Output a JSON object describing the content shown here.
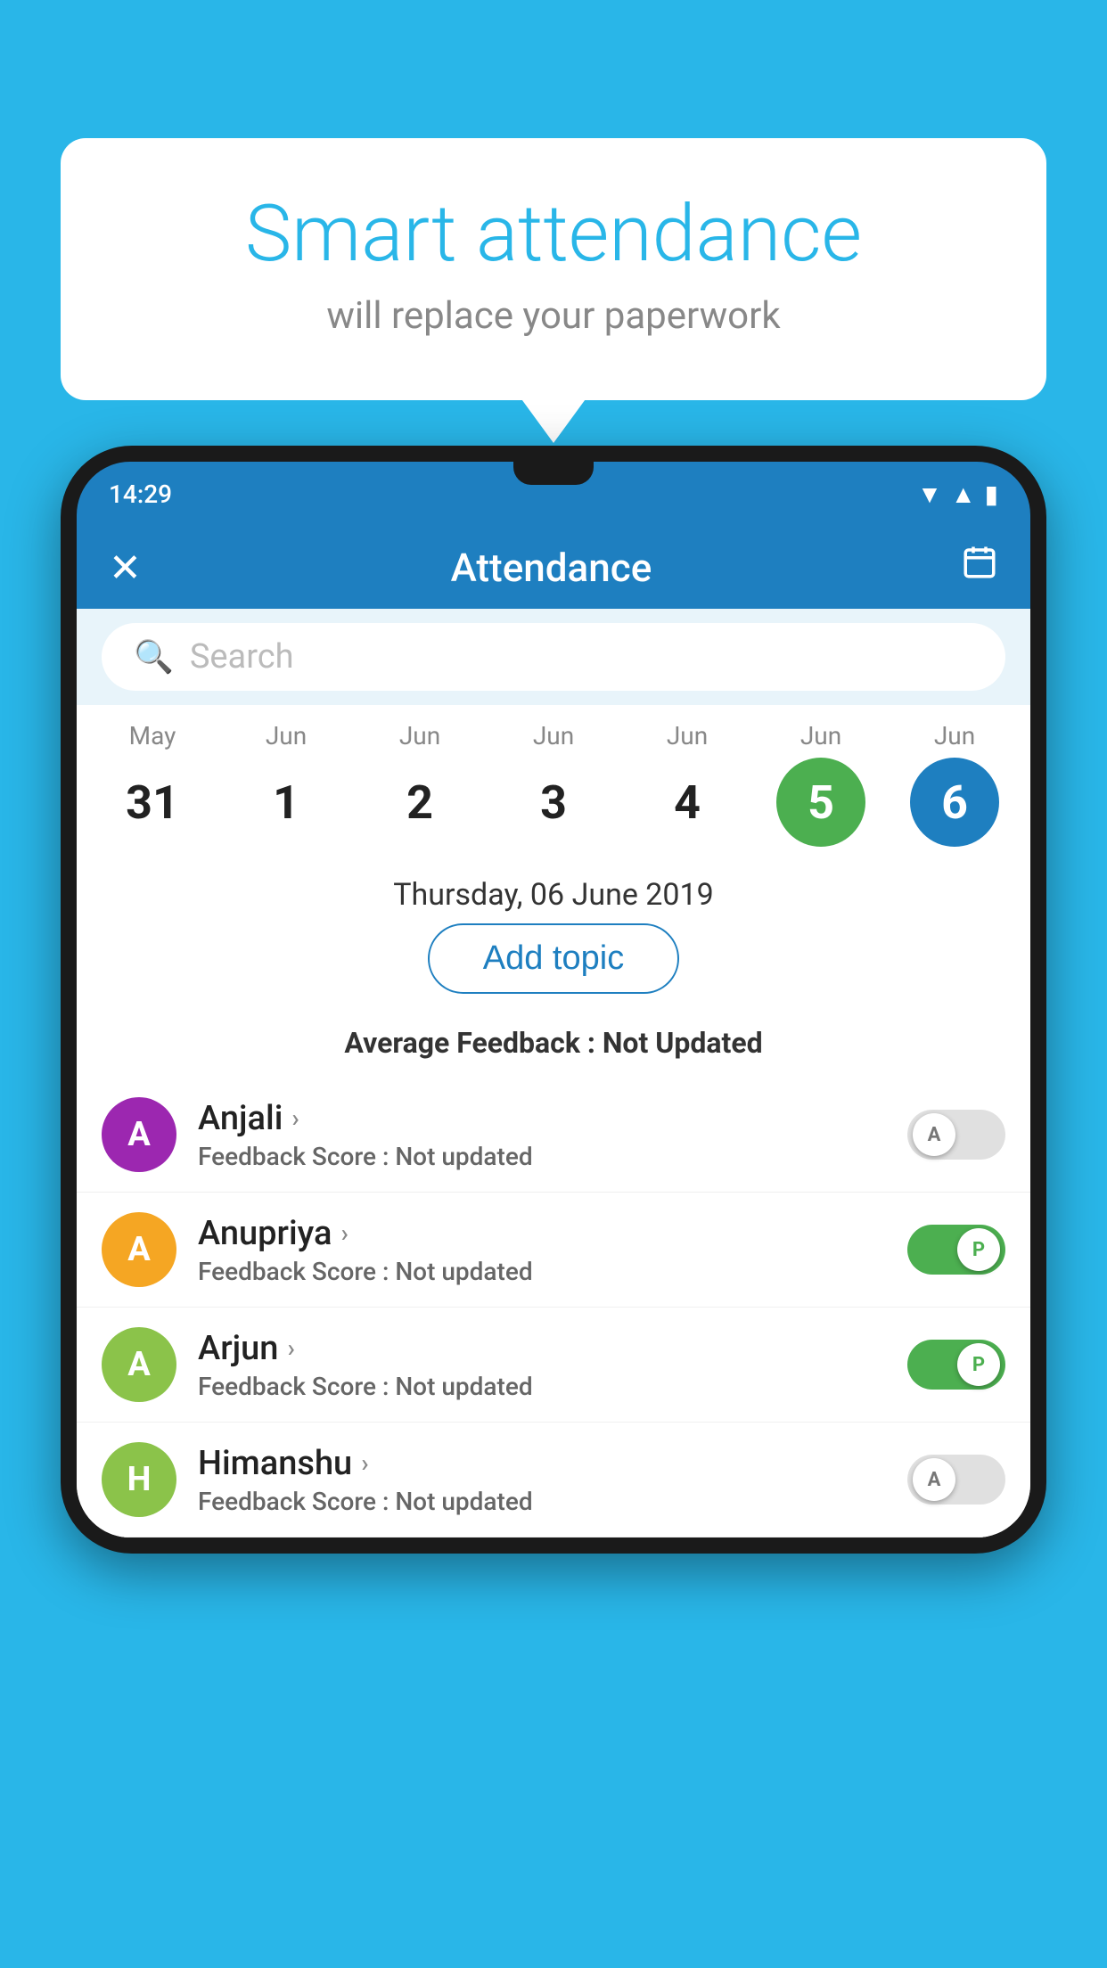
{
  "background_color": "#29b6e8",
  "bubble": {
    "title": "Smart attendance",
    "subtitle": "will replace your paperwork"
  },
  "phone": {
    "time": "14:29",
    "app_bar": {
      "title": "Attendance",
      "close_icon": "✕",
      "calendar_icon": "📅"
    },
    "search": {
      "placeholder": "Search"
    },
    "calendar": {
      "days": [
        {
          "month": "May",
          "num": "31",
          "state": "normal"
        },
        {
          "month": "Jun",
          "num": "1",
          "state": "normal"
        },
        {
          "month": "Jun",
          "num": "2",
          "state": "normal"
        },
        {
          "month": "Jun",
          "num": "3",
          "state": "normal"
        },
        {
          "month": "Jun",
          "num": "4",
          "state": "normal"
        },
        {
          "month": "Jun",
          "num": "5",
          "state": "today"
        },
        {
          "month": "Jun",
          "num": "6",
          "state": "selected"
        }
      ]
    },
    "selected_date": "Thursday, 06 June 2019",
    "add_topic_label": "Add topic",
    "avg_feedback_label": "Average Feedback :",
    "avg_feedback_value": "Not Updated",
    "students": [
      {
        "name": "Anjali",
        "avatar_letter": "A",
        "avatar_color": "#9c27b0",
        "feedback_label": "Feedback Score :",
        "feedback_value": "Not updated",
        "toggle_state": "off",
        "toggle_letter": "A"
      },
      {
        "name": "Anupriya",
        "avatar_letter": "A",
        "avatar_color": "#f5a623",
        "feedback_label": "Feedback Score :",
        "feedback_value": "Not updated",
        "toggle_state": "on",
        "toggle_letter": "P"
      },
      {
        "name": "Arjun",
        "avatar_letter": "A",
        "avatar_color": "#8bc34a",
        "feedback_label": "Feedback Score :",
        "feedback_value": "Not updated",
        "toggle_state": "on",
        "toggle_letter": "P"
      },
      {
        "name": "Himanshu",
        "avatar_letter": "H",
        "avatar_color": "#8bc34a",
        "feedback_label": "Feedback Score :",
        "feedback_value": "Not updated",
        "toggle_state": "off",
        "toggle_letter": "A"
      }
    ]
  }
}
